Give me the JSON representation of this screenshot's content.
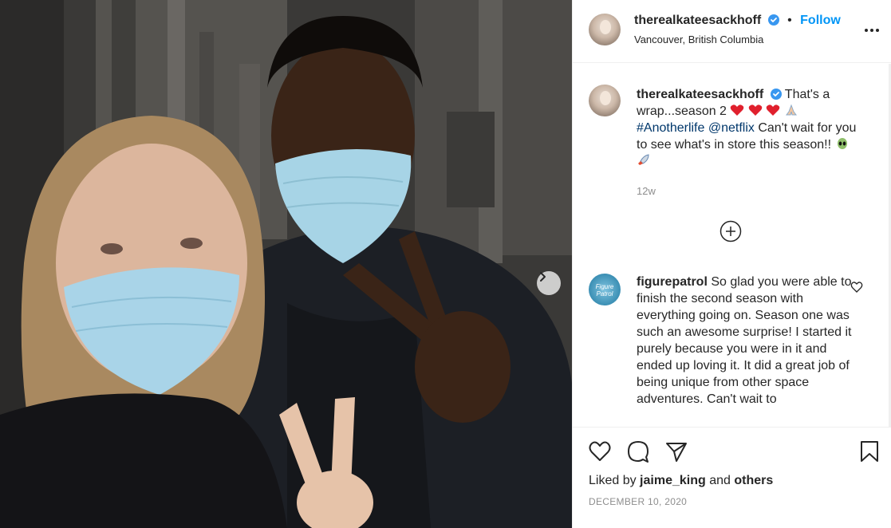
{
  "post": {
    "author": "therealkateesackhoff",
    "follow_label": "Follow",
    "dot": "•",
    "location": "Vancouver, British Columbia"
  },
  "caption": {
    "author": "therealkateesackhoff",
    "text_1": "That's a wrap...season 2",
    "hashtag": "#Anotherlife",
    "mention": "@netflix",
    "text_2": "Can't wait for you to see what's in store this season!!",
    "time": "12w"
  },
  "comments": [
    {
      "author": "figurepatrol",
      "avatar_text": "Figure Patrol",
      "text": "So glad you were able to finish the second season with everything going on. Season one was such an awesome surprise! I started it purely because you were in it and ended up loving it. It did a great job of being unique from other space adventures. Can't wait to"
    }
  ],
  "footer": {
    "liked_by_prefix": "Liked by",
    "liked_by_user": "jaime_king",
    "and": "and",
    "others": "others",
    "date": "DECEMBER 10, 2020"
  },
  "icons": {
    "verified": "verified-badge-icon",
    "more": "more-options-icon",
    "like": "heart-icon",
    "comment": "comment-icon",
    "share": "paper-plane-icon",
    "save": "bookmark-icon",
    "load_more": "plus-circle-icon",
    "comment_like": "heart-small-icon",
    "next": "chevron-right-icon"
  },
  "colors": {
    "link": "#00376b",
    "follow": "#0095f6",
    "heart": "#ed4956",
    "verified": "#3897f0"
  }
}
